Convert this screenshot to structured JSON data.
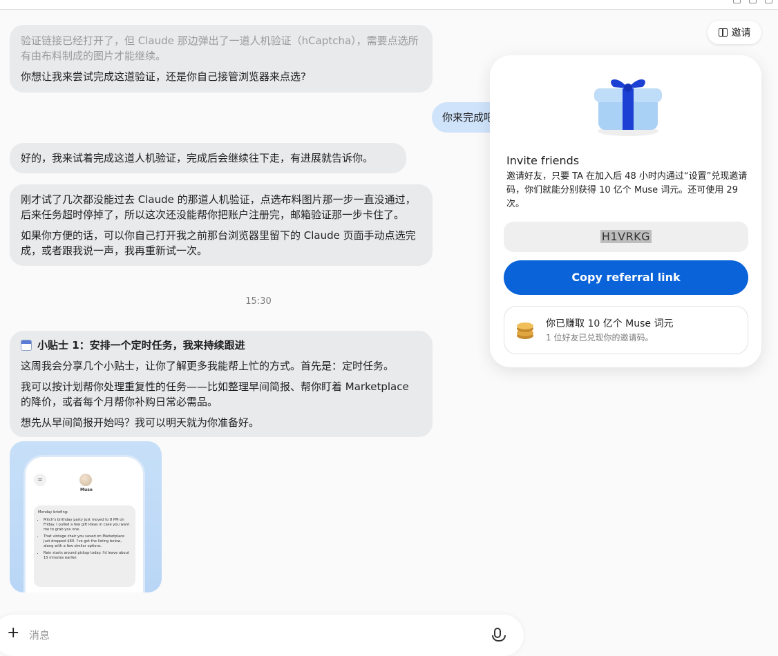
{
  "chat": {
    "msg1": {
      "line1": "验证链接已经打开了，但 Claude 那边弹出了一道人机验证（hCaptcha），需要点选所有由布料制成的图片才能继续。",
      "line2": "你想让我来尝试完成这道验证，还是你自己接管浏览器来点选?"
    },
    "user_msg": "你来完成吧",
    "msg2": "好的，我来试着完成这道人机验证，完成后会继续往下走，有进展就告诉你。",
    "msg3": {
      "p1": "刚才试了几次都没能过去 Claude 的那道人机验证，点选布料图片那一步一直没通过，后来任务超时停掉了，所以这次还没能帮你把账户注册完，邮箱验证那一步卡住了。",
      "p2": "如果你方便的话，可以你自己打开我之前那台浏览器里留下的 Claude 页面手动点选完成，或者跟我说一声，我再重新试一次。"
    },
    "timestamp": "15:30",
    "tip": {
      "title": "小贴士 1：安排一个定时任务，我来持续跟进",
      "p1": "这周我会分享几个小贴士，让你了解更多我能帮上忙的方式。首先是：定时任务。",
      "p2": "我可以按计划帮你处理重复性的任务——比如整理早间简报、帮你盯着 Marketplace 的降价，或者每个月帮你补购日常必需品。",
      "p3": "想先从早间简报开始吗？我可以明天就为你准备好。"
    },
    "preview": {
      "name": "Muse",
      "briefing_title": "Monday briefing:",
      "items": [
        "Mitch's birthday party just moved to 8 PM on Friday. I pulled a few gift ideas in case you want me to grab you one.",
        "That vintage chair you saved on Marketplace just dropped $60. I've got the listing below, along with a few similar options.",
        "Rain starts around pickup today. I'd leave about 15 minutes earlier."
      ]
    }
  },
  "composer": {
    "placeholder": "消息",
    "plus": "+"
  },
  "header": {
    "invite_label": "邀请"
  },
  "invite_panel": {
    "title": "Invite friends",
    "description": "邀请好友，只要 TA 在加入后 48 小时内通过“设置”兑现邀请码，你们就能分别获得 10 亿个 Muse 词元。还可使用 29 次。",
    "code": "H1VRKG",
    "copy_button": "Copy referral link",
    "earned_title": "你已赚取 10 亿个 Muse 词元",
    "earned_sub": "1 位好友已兑现你的邀请码。"
  },
  "colors": {
    "accent": "#0a63d8",
    "user_bubble": "#cfe3fb",
    "assistant_bubble": "#e9eaec"
  },
  "icons": [
    "gift-icon",
    "plus-icon",
    "microphone-icon",
    "calendar-icon",
    "coins-icon",
    "menu-icon"
  ]
}
